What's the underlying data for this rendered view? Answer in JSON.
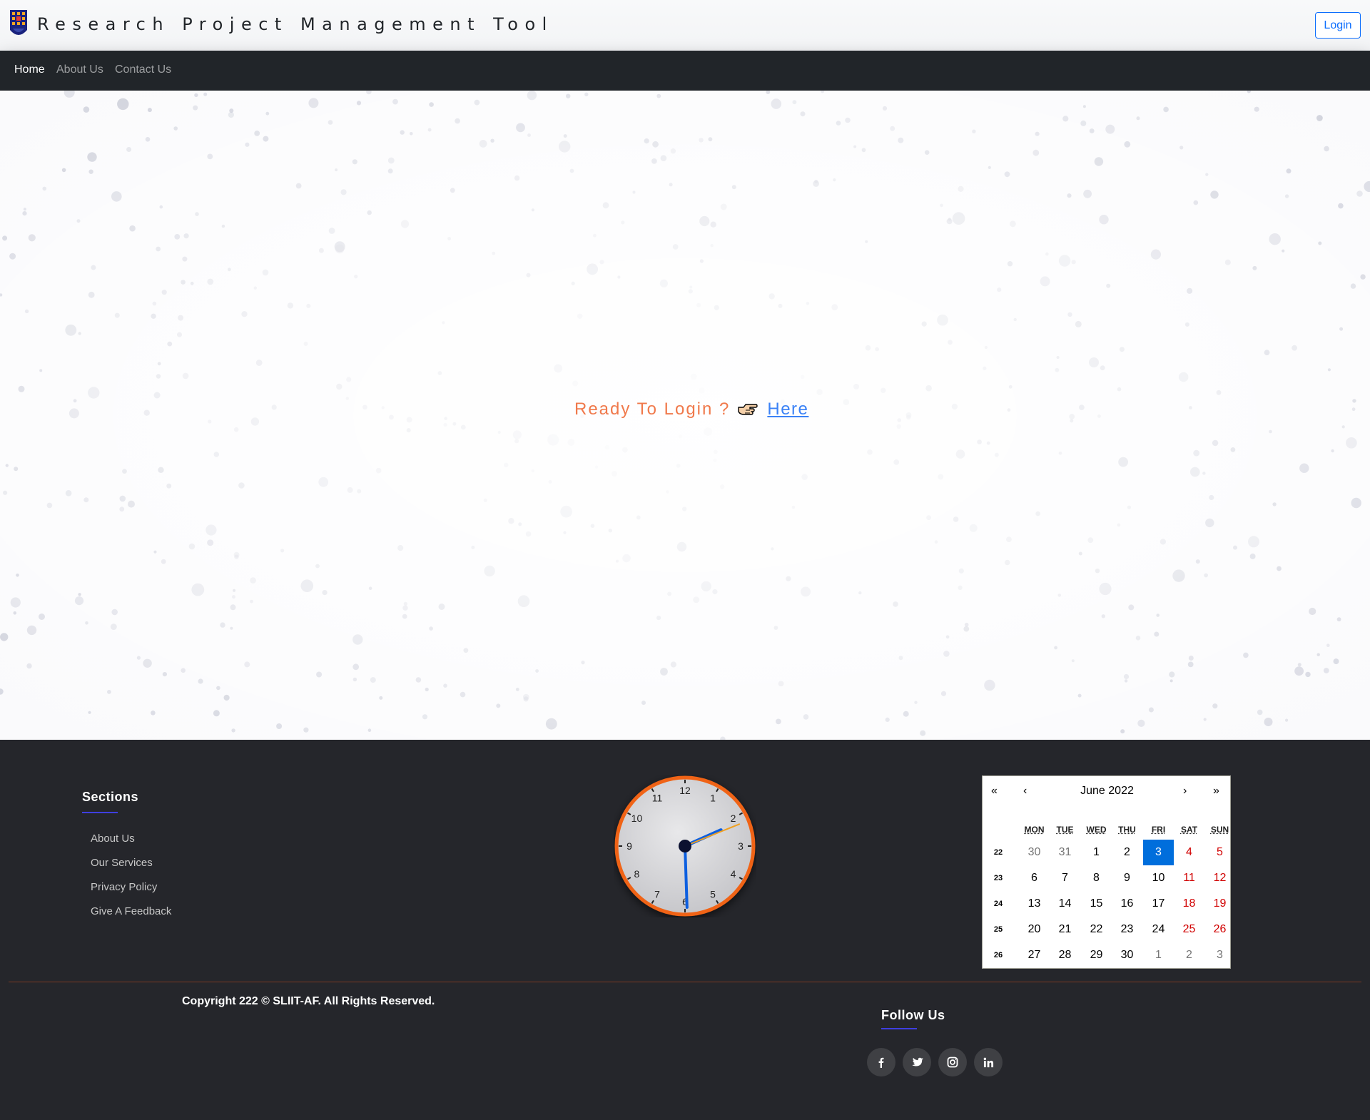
{
  "header": {
    "brand": "Research Project Management Tool",
    "login_label": "Login"
  },
  "nav": {
    "items": [
      "Home",
      "About Us",
      "Contact Us"
    ],
    "active": "Home"
  },
  "hero": {
    "prompt": "Ready To Login ?",
    "link_label": "Here",
    "hand_icon": "pointing-hand-icon"
  },
  "footer": {
    "sections_title": "Sections",
    "links": [
      "About Us",
      "Our Services",
      "Privacy Policy",
      "Give A Feedback"
    ],
    "copyright": "Copyright 222 © SLIIT-AF. All Rights Reserved.",
    "follow_title": "Follow Us",
    "social": [
      "facebook-icon",
      "twitter-icon",
      "instagram-icon",
      "linkedin-icon"
    ],
    "accent": "#3f3fe0"
  },
  "clock": {
    "numerals": [
      "12",
      "1",
      "2",
      "3",
      "4",
      "5",
      "6",
      "7",
      "8",
      "9",
      "10",
      "11"
    ],
    "hour": 2,
    "minute": 30,
    "second": 11,
    "ring_color": "#f06414",
    "hand_color": "#0d5fe0",
    "second_hand_color": "#f0a020"
  },
  "calendar": {
    "nav_first": "«",
    "nav_prev": "‹",
    "title": "June 2022",
    "nav_next": "›",
    "nav_last": "»",
    "weekdays": [
      "MON",
      "TUE",
      "WED",
      "THU",
      "FRI",
      "SAT",
      "SUN"
    ],
    "weeks": [
      {
        "num": "22",
        "days": [
          "30",
          "31",
          "1",
          "2",
          "3",
          "4",
          "5"
        ]
      },
      {
        "num": "23",
        "days": [
          "6",
          "7",
          "8",
          "9",
          "10",
          "11",
          "12"
        ]
      },
      {
        "num": "24",
        "days": [
          "13",
          "14",
          "15",
          "16",
          "17",
          "18",
          "19"
        ]
      },
      {
        "num": "25",
        "days": [
          "20",
          "21",
          "22",
          "23",
          "24",
          "25",
          "26"
        ]
      },
      {
        "num": "26",
        "days": [
          "27",
          "28",
          "29",
          "30",
          "1",
          "2",
          "3"
        ]
      }
    ],
    "today": "3",
    "today_color": "#006edc",
    "weekend_color": "#d10000"
  }
}
